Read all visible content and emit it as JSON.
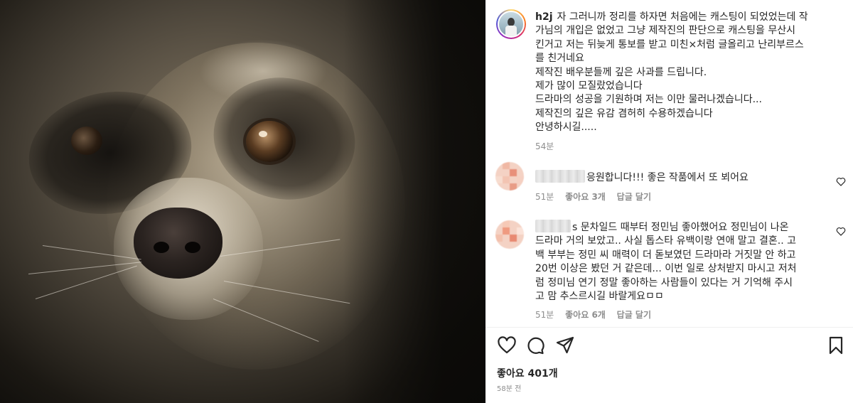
{
  "post": {
    "username": "h2j",
    "caption_lines": [
      "자 그러니까 정리를 하자면 처음에는 캐스팅이 되었었는데 작",
      "가님의 개입은 없었고 그냥 제작진의 판단으로 캐스팅을 무산시",
      "킨거고 저는 뒤늦게 통보를 받고 미친×처럼 글올리고 난리부르스",
      "를 친거네요",
      "제작진 배우분들께 깊은 사과를 드립니다.",
      "제가 많이 모질랐었습니다",
      "드라마의 성공을 기원하며 저는 이만 물러나겠습니다...",
      "제작진의 깊은 유감 겸허히 수용하겠습니다",
      "안녕하시길....."
    ],
    "caption_time": "54분",
    "likes_text": "좋아요 401개",
    "posted_ago": "58분 전"
  },
  "comments": [
    {
      "text_lines": [
        "응원합니다!!! 좋은 작품에서 또 뵈어요"
      ],
      "time": "51분",
      "likes": "좋아요 3개",
      "reply": "답글 달기"
    },
    {
      "text_lines": [
        "s 문차일드 때부터 정민님 좋아했어요 정민님이 나온",
        "드라마 거의 보았고.. 사실 톱스타 유백이랑 연애 말고 결혼.. 고",
        "백 부부는 정민 씨 매력이 더 돋보였던 드라마라 거짓말 안 하고",
        "20번 이상은 봤던 거 같은데... 이번 일로 상처받지 마시고 저처",
        "럼 정미님 연기 정말 좋아하는 사람들이 있다는 거 기억해 주시",
        "고 맘 추스르시길 바랄게요ㅁㅁ"
      ],
      "time": "51분",
      "likes": "좋아요 6개",
      "reply": "답글 달기"
    }
  ],
  "icons": {
    "like": "heart-icon",
    "comment": "comment-icon",
    "share": "paper-plane-icon",
    "save": "bookmark-icon",
    "comment_like": "heart-icon"
  },
  "colors": {
    "text": "#262626",
    "muted": "#8e8e8e",
    "story_ring": [
      "#feda75",
      "#fa7e1e",
      "#d62976",
      "#962fbf",
      "#4f5bd5"
    ]
  }
}
